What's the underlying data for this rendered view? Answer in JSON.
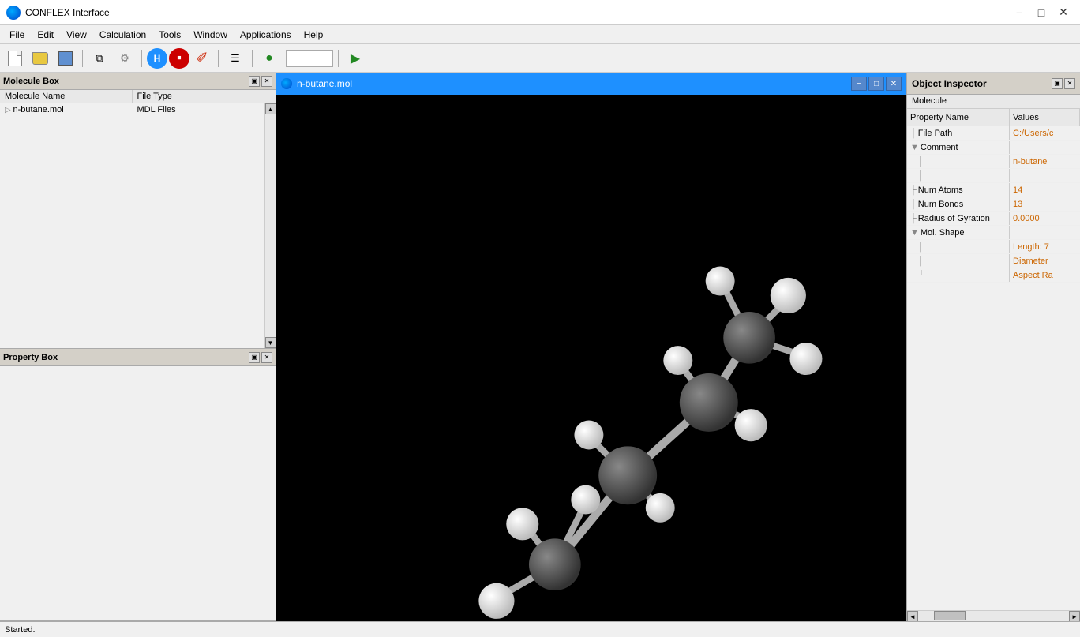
{
  "app": {
    "title": "CONFLEX Interface",
    "icon_label": "conflex-icon"
  },
  "title_bar": {
    "title": "CONFLEX Interface",
    "minimize_label": "−",
    "maximize_label": "□",
    "close_label": "✕"
  },
  "menu": {
    "items": [
      "File",
      "Edit",
      "View",
      "Calculation",
      "Tools",
      "Window",
      "Applications",
      "Help"
    ]
  },
  "molecule_box": {
    "title": "Molecule Box",
    "columns": [
      "Molecule Name",
      "File Type"
    ],
    "rows": [
      {
        "name": "n-butane.mol",
        "type": "MDL Files"
      }
    ]
  },
  "property_box": {
    "title": "Property Box"
  },
  "viewer": {
    "title": "n-butane.mol",
    "minimize_label": "−",
    "restore_label": "□",
    "close_label": "✕"
  },
  "object_inspector": {
    "title": "Object Inspector",
    "subtitle": "Molecule",
    "col_property": "Property Name",
    "col_values": "Values",
    "rows": [
      {
        "indent": 0,
        "tree": "",
        "name": "File Path",
        "value": "C:/Users/c",
        "expandable": false
      },
      {
        "indent": 0,
        "tree": "▼",
        "name": "Comment",
        "value": "",
        "expandable": true
      },
      {
        "indent": 1,
        "tree": "",
        "name": "",
        "value": "n-butane",
        "expandable": false
      },
      {
        "indent": 1,
        "tree": "",
        "name": "",
        "value": "",
        "expandable": false
      },
      {
        "indent": 0,
        "tree": "",
        "name": "Num Atoms",
        "value": "14",
        "expandable": false
      },
      {
        "indent": 0,
        "tree": "",
        "name": "Num Bonds",
        "value": "13",
        "expandable": false
      },
      {
        "indent": 0,
        "tree": "",
        "name": "Radius of Gyration",
        "value": "0.0000",
        "expandable": false
      },
      {
        "indent": 0,
        "tree": "▼",
        "name": "Mol. Shape",
        "value": "",
        "expandable": true
      },
      {
        "indent": 1,
        "tree": "",
        "name": "",
        "value": "Length: 7",
        "expandable": false
      },
      {
        "indent": 1,
        "tree": "",
        "name": "",
        "value": "Diameter",
        "expandable": false
      },
      {
        "indent": 1,
        "tree": "",
        "name": "",
        "value": "Aspect Ra",
        "expandable": false
      }
    ]
  },
  "status_bar": {
    "text": "Started."
  }
}
